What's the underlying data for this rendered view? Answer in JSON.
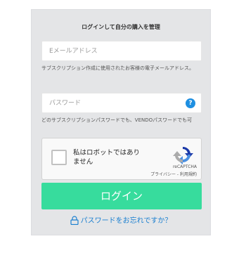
{
  "form": {
    "title": "ログインして自分の購入を管理",
    "email": {
      "placeholder": "Eメールアドレス",
      "value": "",
      "hint": "サブスクリプション作成に使用されたお客様の電子メールアドレス。"
    },
    "password": {
      "placeholder": "パスワード",
      "value": "",
      "help_icon": "question-circle-icon",
      "hint": "どのサブスクリプションパスワードでも、VENDOパスワードでも可"
    },
    "captcha": {
      "checkbox_label": "私はロボットではありません",
      "brand": "reCAPTCHA",
      "links": "プライバシー - 利用規約"
    },
    "login_label": "ログイン",
    "forgot_label": "パスワードをお忘れですか？",
    "forgot_icon": "lock-icon"
  },
  "colors": {
    "panel_bg": "#e4e5e7",
    "button": "#37dc9d",
    "link": "#1a7fd0",
    "help_icon": "#1e8fe1"
  }
}
